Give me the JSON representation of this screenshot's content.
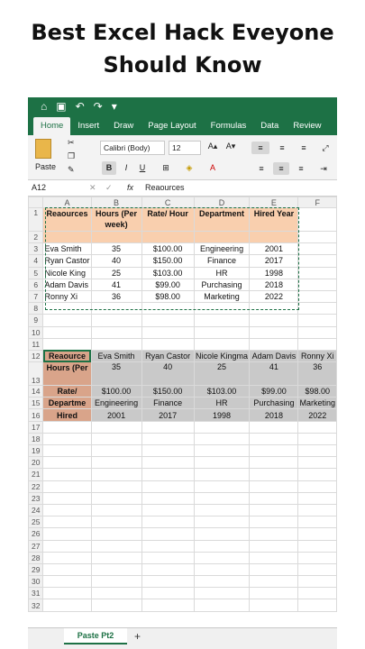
{
  "headline": {
    "line1": "Best Excel Hack Eveyone",
    "line2": "Should Know"
  },
  "quick_access": {
    "home_icon": "home-icon",
    "save_icon": "save-icon",
    "undo_icon": "undo-icon",
    "redo_icon": "redo-icon",
    "more_icon": "more-icon"
  },
  "tabs": [
    "Home",
    "Insert",
    "Draw",
    "Page Layout",
    "Formulas",
    "Data",
    "Review"
  ],
  "ribbon": {
    "paste": "Paste",
    "font_name": "Calibri (Body)",
    "font_size": "12",
    "grow": "A▴",
    "shrink": "A▾",
    "bold": "B",
    "italic": "I",
    "underline": "U"
  },
  "formula_bar": {
    "name_box": "A12",
    "fx": "fx",
    "value": "Reaources"
  },
  "columns": [
    "A",
    "B",
    "C",
    "D",
    "E",
    "F"
  ],
  "rows": {
    "r1": [
      "Reaources",
      "Hours (Per week)",
      "Rate/ Hour",
      "Department",
      "Hired Year"
    ],
    "r3": [
      "Eva Smith",
      "35",
      "$100.00",
      "Engineering",
      "2001"
    ],
    "r4": [
      "Ryan Castor",
      "40",
      "$150.00",
      "Finance",
      "2017"
    ],
    "r5": [
      "Nicole King",
      "25",
      "$103.00",
      "HR",
      "1998"
    ],
    "r6": [
      "Adam Davis",
      "41",
      "$99.00",
      "Purchasing",
      "2018"
    ],
    "r7": [
      "Ronny Xi",
      "36",
      "$98.00",
      "Marketing",
      "2022"
    ],
    "r12": [
      "Reaource",
      "Eva Smith",
      "Ryan Castor",
      "Nicole Kingma",
      "Adam Davis",
      "Ronny Xi"
    ],
    "r13": [
      "Hours (Per",
      "35",
      "40",
      "25",
      "41",
      "36"
    ],
    "r14": [
      "Rate/",
      "$100.00",
      "$150.00",
      "$103.00",
      "$99.00",
      "$98.00"
    ],
    "r15": [
      "Departme",
      "Engineering",
      "Finance",
      "HR",
      "Purchasing",
      "Marketing"
    ],
    "r16": [
      "Hired",
      "2001",
      "2017",
      "1998",
      "2018",
      "2022"
    ]
  },
  "sheet_tab": "Paste Pt2",
  "add_sheet": "+",
  "colors": {
    "excel_green": "#1d7145",
    "header_peach": "#f9cfae",
    "label_peach": "#d9a48a",
    "gray_fill": "#c9c9c9"
  }
}
